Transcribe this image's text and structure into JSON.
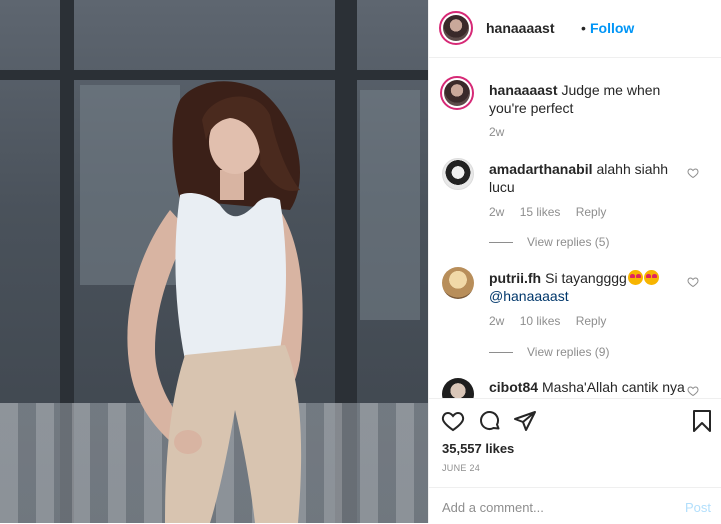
{
  "header": {
    "username": "hanaaaast",
    "dot": "•",
    "follow_label": "Follow"
  },
  "caption": {
    "username": "hanaaaast",
    "text": "Judge me when you're perfect",
    "time": "2w"
  },
  "comments": [
    {
      "username": "amadarthanabil",
      "text": "alahh siahh lucu",
      "time": "2w",
      "likes": "15 likes",
      "reply": "Reply",
      "view_replies": "View replies (5)"
    },
    {
      "username": "putrii.fh",
      "text": "Si tayangggg",
      "mention": "@hanaaaast",
      "time": "2w",
      "likes": "10 likes",
      "reply": "Reply",
      "view_replies": "View replies (9)"
    },
    {
      "username": "cibot84",
      "text": "Masha'Allah cantik nya"
    }
  ],
  "likes": "35,557 likes",
  "date": "JUNE 24",
  "add_comment": {
    "placeholder": "Add a comment...",
    "post_label": "Post"
  },
  "colors": {
    "follow": "#0095f6",
    "muted": "#8e8e8e",
    "text": "#262626",
    "post_disabled": "#b2dffc"
  },
  "icons": [
    "heart-icon",
    "comment-icon",
    "share-icon",
    "bookmark-icon"
  ]
}
